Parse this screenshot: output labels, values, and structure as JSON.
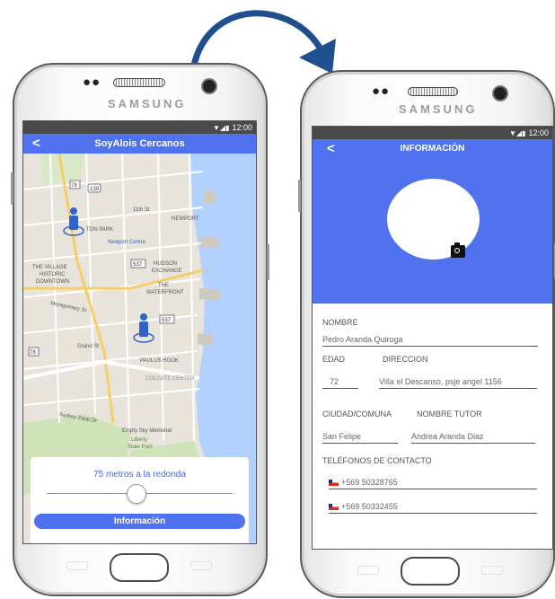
{
  "arrow": {
    "icon": "curved-arrow-icon",
    "color": "#1f4f8f"
  },
  "phone_brand": "SAMSUNG",
  "status": {
    "time": "12:00"
  },
  "colors": {
    "accent": "#5072ee",
    "map_water": "#b3d1ff",
    "map_park": "#cfe3b9"
  },
  "map_screen": {
    "back_icon": "back-chevron-icon",
    "title": "SoyAlois Cercanos",
    "map_labels": [
      "TON PARK",
      "Newport Centre",
      "NEWPORT",
      "THE VILLAGE",
      "HISTORIC",
      "DOWNTOWN",
      "HUDSON",
      "EXCHANGE",
      "THE",
      "WATERFRONT",
      "Montgomery St",
      "Grand St",
      "PAULUS HOOK",
      "COLGATE CENTER",
      "Empty Sky Memorial",
      "Liberty",
      "State Park",
      "Audrey Zapp Dr",
      "11th St"
    ],
    "route_shields": [
      "139",
      "78",
      "537",
      "537",
      "78"
    ],
    "radius_label": "75 metros a la redonda",
    "slider_value": 0.5,
    "info_button": "Información"
  },
  "info_screen": {
    "back_icon": "back-chevron-icon",
    "title": "INFORMACIÓN",
    "camera_icon": "camera-icon",
    "fields": {
      "nombre_label": "NOMBRE",
      "nombre_value": "Pedro Aranda Quiroga",
      "edad_label": "EDAD",
      "edad_value": "72",
      "direccion_label": "DIRECCION",
      "direccion_value": "Villa el Descanso, psje angel 1156",
      "ciudad_label": "CIUDAD/COMUNA",
      "ciudad_value": "San Felipe",
      "tutor_label": "NOMBRE TUTOR",
      "tutor_value": "Andrea Aranda Diaz",
      "telefonos_label": "TELÉFONOS DE CONTACTO",
      "phone1": "+569 50328765",
      "phone2": "+569 50332455"
    }
  }
}
